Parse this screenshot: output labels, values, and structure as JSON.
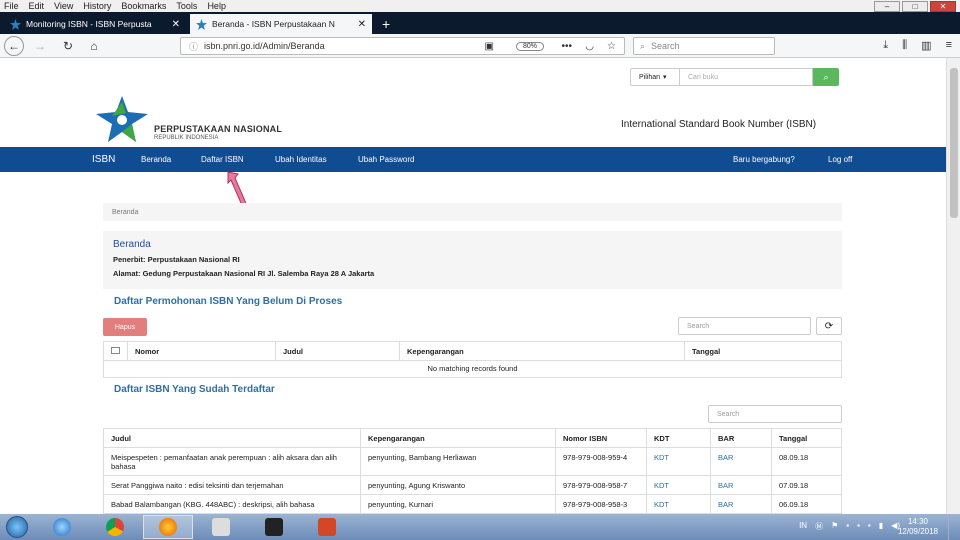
{
  "menubar": {
    "items": [
      "File",
      "Edit",
      "View",
      "History",
      "Bookmarks",
      "Tools",
      "Help"
    ]
  },
  "tabs": [
    {
      "title": "Monitoring ISBN - ISBN Perpusta",
      "active": false
    },
    {
      "title": "Beranda - ISBN Perpustakaan N",
      "active": true
    }
  ],
  "nav": {
    "url": "isbn.pnri.go.id/Admin/Beranda",
    "zoom": "80%",
    "more": "•••",
    "search_placeholder": "Search"
  },
  "site": {
    "search_select": "Pilihan",
    "search_placeholder": "Cari buku",
    "org_name": "PERPUSTAKAAN NASIONAL",
    "org_sub": "REPUBLIK INDONESIA",
    "isbn_title": "International Standard Book Number (ISBN)",
    "nav_brand": "ISBN",
    "nav_items": [
      "Beranda",
      "Daftar ISBN",
      "Ubah Identitas",
      "Ubah Password"
    ],
    "nav_right": [
      "Baru bergabung?",
      "Log off"
    ],
    "breadcrumb": "Beranda",
    "info": {
      "title": "Beranda",
      "publisher": "Penerbit: Perpustakaan Nasional RI",
      "address": "Alamat: Gedung Perpustakaan Nasional RI Jl. Salemba Raya 28 A Jakarta"
    },
    "section1": {
      "title": "Daftar Permohonan ISBN Yang Belum Di Proses",
      "delete_label": "Hapus",
      "search_placeholder": "Search",
      "refresh": "⟳",
      "columns": [
        "Nomor",
        "Judul",
        "Kepengarangan",
        "Tanggal"
      ],
      "empty": "No matching records found"
    },
    "section2": {
      "title": "Daftar ISBN Yang Sudah Terdaftar",
      "search_placeholder": "Search",
      "columns": [
        "Judul",
        "Kepengarangan",
        "Nomor ISBN",
        "KDT",
        "BAR",
        "Tanggal"
      ],
      "rows": [
        {
          "judul": "Meispespeten : pemanfaatan anak perempuan : alih aksara dan alih bahasa",
          "kep": "penyunting, Bambang Herliawan",
          "isbn": "978-979-008-959-4",
          "kdt": "KDT",
          "bar": "BAR",
          "tgl": "08.09.18"
        },
        {
          "judul": "Serat Panggiwa naito : edisi teksinti dan terjemahan",
          "kep": "penyunting, Agung Kriswanto",
          "isbn": "978-979-008-958-7",
          "kdt": "KDT",
          "bar": "BAR",
          "tgl": "07.09.18"
        },
        {
          "judul": "Babad Balambangan (KBG. 448ABC) : deskripsi, alih bahasa",
          "kep": "penyunting, Kurnari",
          "isbn": "978-979-008-958-3",
          "kdt": "KDT",
          "bar": "BAR",
          "tgl": "06.09.18"
        }
      ]
    }
  },
  "taskbar": {
    "lang": "IN",
    "time": "14:30",
    "date": "12/09/2018"
  },
  "colors": {
    "nav_blue": "#0f4c92",
    "title_blue": "#2f6fa3",
    "go_green": "#5cb85c",
    "hapus_red": "#d9534f",
    "tab_dark": "#0c1a2e"
  }
}
